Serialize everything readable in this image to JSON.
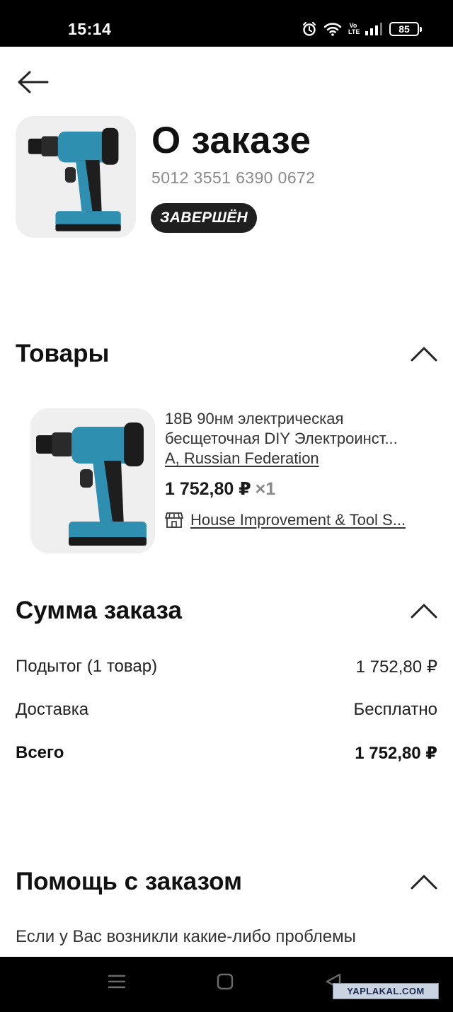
{
  "status_bar": {
    "time": "15:14",
    "volte": "Vo LTE",
    "battery": "85",
    "icons": [
      "alarm-icon",
      "wifi-icon",
      "volte-icon",
      "signal-icon",
      "battery-icon"
    ]
  },
  "header": {
    "back_icon": "arrow-left-icon",
    "title": "О заказе",
    "order_number": "5012 3551 6390 0672",
    "status": "ЗАВЕРШЁН"
  },
  "products_section": {
    "title": "Товары",
    "expanded": true,
    "items": [
      {
        "title_line1": "18В 90нм электрическая",
        "title_line2": "бесщеточная DIY Электроинст...",
        "variant": "A, Russian Federation",
        "price": "1 752,80 ₽",
        "quantity": "×1",
        "store_icon": "store-icon",
        "store": "House Improvement & Tool S..."
      }
    ]
  },
  "summary_section": {
    "title": "Сумма заказа",
    "expanded": true,
    "rows": [
      {
        "label": "Подытог (1 товар)",
        "value": "1 752,80 ₽"
      },
      {
        "label": "Доставка",
        "value": "Бесплатно"
      },
      {
        "label": "Всего",
        "value": "1 752,80 ₽"
      }
    ]
  },
  "help_section": {
    "title": "Помощь с заказом",
    "expanded": true,
    "text": "Если у Вас возникли какие-либо проблемы"
  },
  "nav_bar": {
    "icons": [
      "menu-icon",
      "home-icon",
      "back-triangle-icon"
    ]
  },
  "watermark": "YAPLAKAL.COM",
  "colors": {
    "badge_bg": "#1f1f1f",
    "thumb_bg": "#efefef",
    "drill_teal": "#2e8fb0",
    "secondary_text": "#8a8a8a"
  }
}
